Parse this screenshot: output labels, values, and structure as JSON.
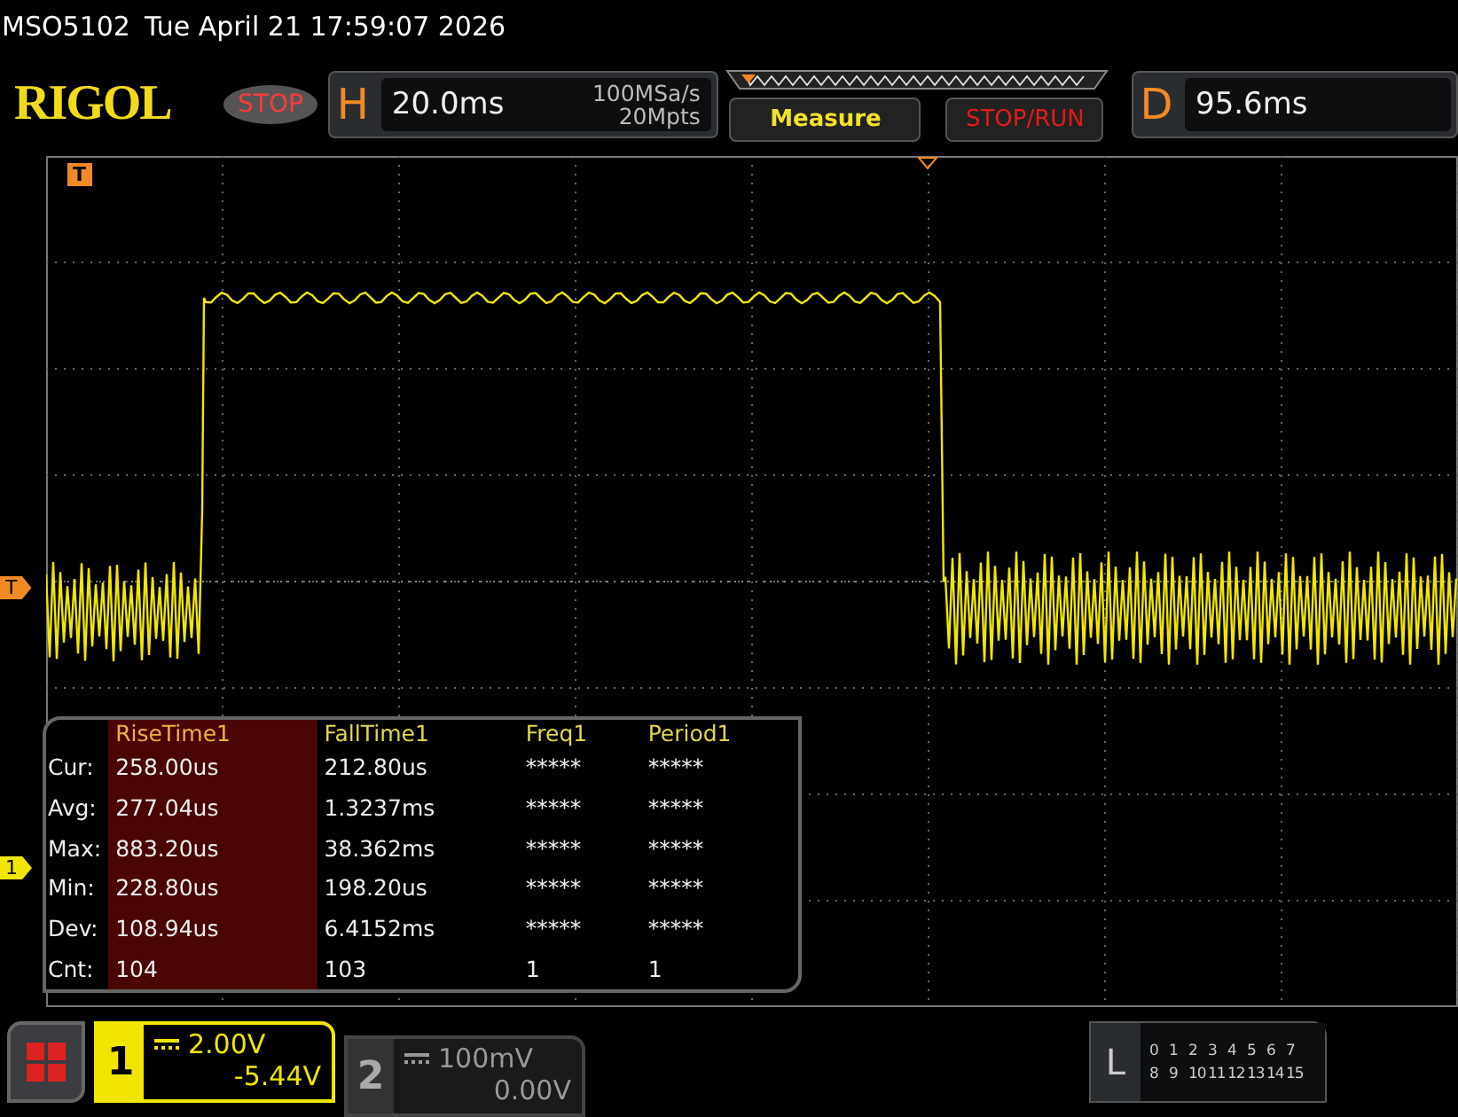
{
  "status_line": {
    "model": "MSO5102",
    "datetime": "Tue April 21 17:59:07 2026"
  },
  "header": {
    "logo": "RIGOL",
    "run_state": "STOP",
    "horizontal": {
      "label": "H",
      "timebase": "20.0ms",
      "sample_rate": "100MSa/s",
      "memory_depth": "20Mpts"
    },
    "buttons": [
      {
        "label": "Measure",
        "kind": "menu"
      },
      {
        "label": "STOP/RUN",
        "kind": "action"
      }
    ],
    "delay": {
      "label": "D",
      "value": "95.6ms"
    }
  },
  "markers": {
    "trigger_position": "T",
    "trigger_level": "T",
    "channel_1": "1"
  },
  "measurements": {
    "columns": [
      {
        "label": "RiseTime1",
        "selected": true
      },
      {
        "label": "FallTime1",
        "selected": false
      },
      {
        "label": "Freq1",
        "selected": false
      },
      {
        "label": "Period1",
        "selected": false
      }
    ],
    "rows": [
      {
        "label": "Cur:",
        "values": [
          "258.00us",
          "212.80us",
          "*****",
          "*****"
        ]
      },
      {
        "label": "Avg:",
        "values": [
          "277.04us",
          "1.3237ms",
          "*****",
          "*****"
        ]
      },
      {
        "label": "Max:",
        "values": [
          "883.20us",
          "38.362ms",
          "*****",
          "*****"
        ]
      },
      {
        "label": "Min:",
        "values": [
          "228.80us",
          "198.20us",
          "*****",
          "*****"
        ]
      },
      {
        "label": "Dev:",
        "values": [
          "108.94us",
          "6.4152ms",
          "*****",
          "*****"
        ]
      },
      {
        "label": "Cnt:",
        "values": [
          "104",
          "103",
          "1",
          "1"
        ]
      }
    ]
  },
  "channels": [
    {
      "number": "1",
      "scale": "2.00V",
      "offset": "-5.44V",
      "active": true
    },
    {
      "number": "2",
      "scale": "100mV",
      "offset": "0.00V",
      "active": false
    }
  ],
  "logic": {
    "label": "L",
    "rows": [
      [
        "0",
        "1",
        "2",
        "3",
        "4",
        "5",
        "6",
        "7"
      ],
      [
        "8",
        "9",
        "10",
        "11",
        "12",
        "13",
        "14",
        "15"
      ]
    ]
  }
}
